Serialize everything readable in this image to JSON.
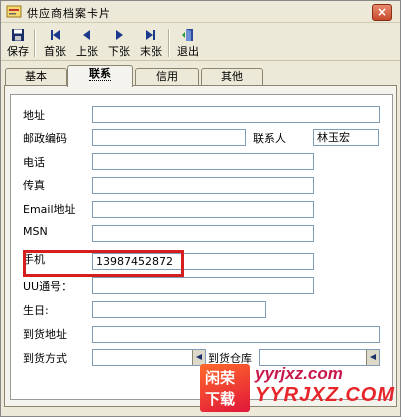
{
  "window": {
    "title": "供应商档案卡片",
    "close_label": "×"
  },
  "toolbar": {
    "save_label": "保存",
    "first_label": "首张",
    "prev_label": "上张",
    "next_label": "下张",
    "last_label": "末张",
    "exit_label": "退出"
  },
  "tabs": {
    "basic": "基本",
    "contact": "联系",
    "credit": "信用",
    "other": "其他",
    "active": "contact"
  },
  "form": {
    "address_label": "地址",
    "address_value": "",
    "postcode_label": "邮政编码",
    "postcode_value": "",
    "contact_person_label": "联系人",
    "contact_person_value": "林玉宏",
    "phone_label": "电话",
    "phone_value": "",
    "fax_label": "传真",
    "fax_value": "",
    "email_label": "Email地址",
    "email_value": "",
    "msn_label": "MSN",
    "msn_value": "",
    "mobile_label": "手机",
    "mobile_value": "13987452872",
    "uu_label": "UU通号：",
    "uu_value": "",
    "birthday_label": "生日:",
    "birthday_value": "",
    "delivery_address_label": "到货地址",
    "delivery_address_value": "",
    "delivery_method_label": "到货方式",
    "delivery_method_value": "",
    "delivery_warehouse_label": "到货仓库",
    "delivery_warehouse_value": ""
  },
  "watermark": {
    "logo_top": "闲荣",
    "logo_bottom": "下载",
    "line1": "yyrjxz.com",
    "line2": "YYRJXZ.COM"
  },
  "colors": {
    "highlight": "#d51e1e",
    "field_border": "#7f9db9"
  }
}
